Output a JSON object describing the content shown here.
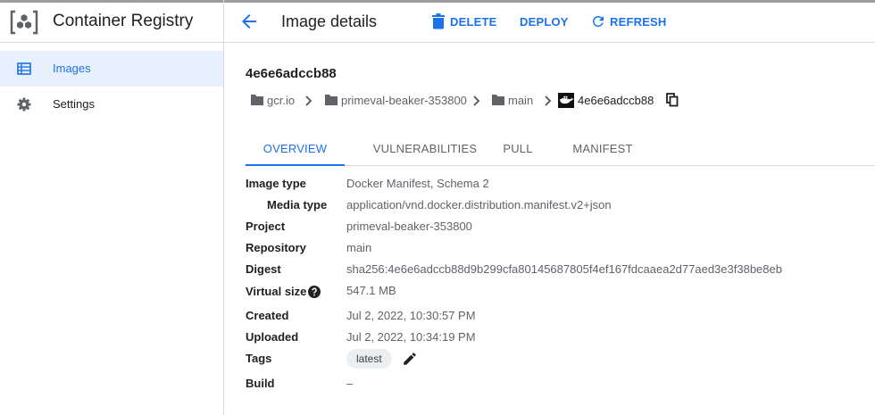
{
  "app": {
    "title": "Container Registry"
  },
  "sidebar": {
    "items": [
      {
        "label": "Images",
        "icon": "list-icon",
        "active": true
      },
      {
        "label": "Settings",
        "icon": "gear-icon",
        "active": false
      }
    ]
  },
  "header": {
    "title": "Image details",
    "delete_label": "DELETE",
    "deploy_label": "DEPLOY",
    "refresh_label": "REFRESH"
  },
  "image": {
    "digest_short": "4e6e6adccb88"
  },
  "breadcrumb": [
    {
      "label": "gcr.io",
      "icon": "folder-icon"
    },
    {
      "label": "primeval-beaker-353800",
      "icon": "folder-icon"
    },
    {
      "label": "main",
      "icon": "folder-icon"
    },
    {
      "label": "4e6e6adccb88",
      "icon": "docker-icon"
    }
  ],
  "tabs": [
    {
      "label": "OVERVIEW",
      "active": true
    },
    {
      "label": "VULNERABILITIES",
      "active": false
    },
    {
      "label": "PULL",
      "active": false
    },
    {
      "label": "MANIFEST",
      "active": false
    }
  ],
  "details": {
    "image_type_label": "Image type",
    "image_type": "Docker Manifest, Schema 2",
    "media_type_label": "Media type",
    "media_type": "application/vnd.docker.distribution.manifest.v2+json",
    "project_label": "Project",
    "project": "primeval-beaker-353800",
    "repository_label": "Repository",
    "repository": "main",
    "digest_label": "Digest",
    "digest": "sha256:4e6e6adccb88d9b299cfa80145687805f4ef167fdcaaea2d77aed3e3f38be8eb",
    "virtual_size_label": "Virtual size",
    "virtual_size": "547.1 MB",
    "created_label": "Created",
    "created": "Jul 2, 2022, 10:30:57 PM",
    "uploaded_label": "Uploaded",
    "uploaded": "Jul 2, 2022, 10:34:19 PM",
    "tags_label": "Tags",
    "tag": "latest",
    "build_label": "Build",
    "build": "–"
  },
  "colors": {
    "accent": "#1a73e8",
    "active_bg": "#e8f0fe",
    "text": "#202124",
    "muted": "#5f6368",
    "divider": "#dadce0"
  }
}
